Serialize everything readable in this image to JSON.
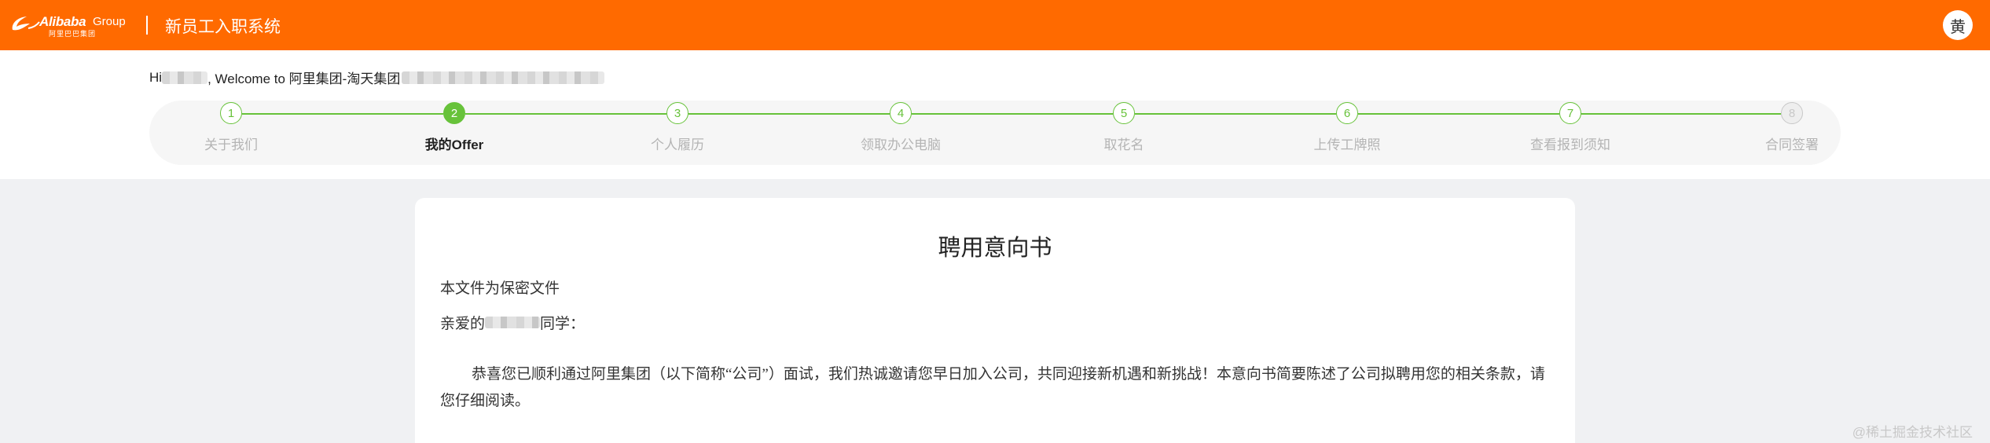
{
  "header": {
    "logo_brand": "Alibaba",
    "logo_group": "Group",
    "logo_sub": "阿里巴巴集团",
    "system_title": "新员工入职系统",
    "avatar_text": "黄",
    "bg_color": "#ff6a00"
  },
  "welcome": {
    "prefix": "Hi",
    "middle": ", Welcome to 阿里集团-淘天集团"
  },
  "steps": [
    {
      "num": "1",
      "label": "关于我们",
      "state": "done"
    },
    {
      "num": "2",
      "label": "我的Offer",
      "state": "active"
    },
    {
      "num": "3",
      "label": "个人履历",
      "state": "todo"
    },
    {
      "num": "4",
      "label": "领取办公电脑",
      "state": "todo"
    },
    {
      "num": "5",
      "label": "取花名",
      "state": "todo"
    },
    {
      "num": "6",
      "label": "上传工牌照",
      "state": "todo"
    },
    {
      "num": "7",
      "label": "查看报到须知",
      "state": "todo"
    },
    {
      "num": "8",
      "label": "合同签署",
      "state": "disabled"
    }
  ],
  "document": {
    "title": "聘用意向书",
    "confidential": "本文件为保密文件",
    "greeting_prefix": "亲爱的",
    "greeting_suffix": "同学：",
    "paragraph": "恭喜您已顺利通过阿里集团（以下简称“公司”）面试，我们热诚邀请您早日加入公司，共同迎接新机遇和新挑战！本意向书简要陈述了公司拟聘用您的相关条款，请您仔细阅读。"
  },
  "watermark": "@稀土掘金技术社区",
  "colors": {
    "accent": "#ff6a00",
    "step_green": "#67c23a"
  }
}
